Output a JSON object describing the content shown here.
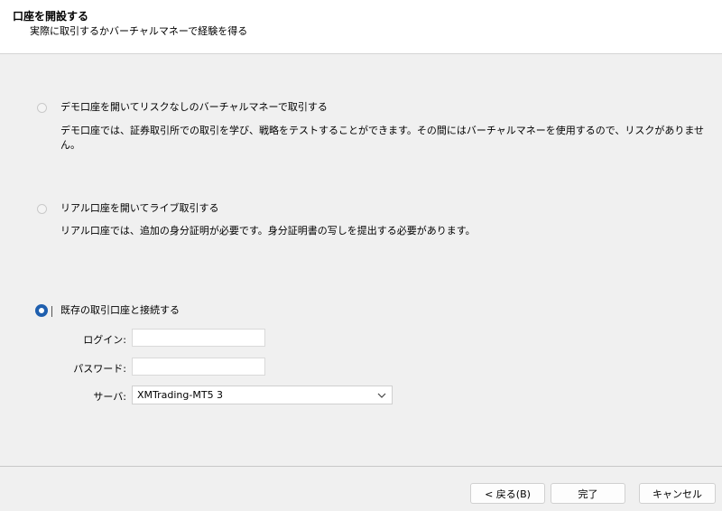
{
  "header": {
    "title": "口座を開設する",
    "subtitle": "実際に取引するかバーチャルマネーで経験を得る"
  },
  "options": [
    {
      "label": "デモ口座を開いてリスクなしのバーチャルマネーで取引する",
      "description": "デモ口座では、証券取引所での取引を学び、戦略をテストすることができます。その間にはバーチャルマネーを使用するので、リスクがありません。",
      "checked": false
    },
    {
      "label": "リアル口座を開いてライブ取引する",
      "description": "リアル口座では、追加の身分証明が必要です。身分証明書の写しを提出する必要があります。",
      "checked": false
    },
    {
      "label": "既存の取引口座と接続する",
      "checked": true
    }
  ],
  "form": {
    "login_label": "ログイン:",
    "login_value": "",
    "password_label": "パスワード:",
    "password_value": "",
    "server_label": "サーバ:",
    "server_value": "XMTrading-MT5 3"
  },
  "buttons": {
    "back": "< 戻る(B)",
    "finish": "完了",
    "cancel": "キャンセル"
  },
  "colors": {
    "accent": "#1f5fae",
    "background": "#f0f0f0"
  }
}
